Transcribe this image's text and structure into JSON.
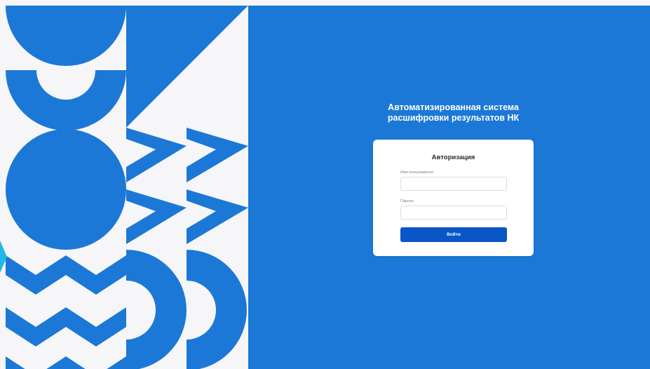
{
  "colors": {
    "brand_blue": "#1c78d6",
    "button_blue": "#0a56c6",
    "background_light": "#f6f6f8",
    "edge_accent": "#20b8e8"
  },
  "header": {
    "title": "Автоматизированная система\nрасшифровки результатов НК"
  },
  "login": {
    "title": "Авторизация",
    "username_label": "Имя пользователя",
    "username_value": "",
    "password_label": "Пароль",
    "password_value": "",
    "submit_label": "Войти"
  },
  "decoration": {
    "pattern": "geometric-shapes",
    "edge_icon": "chevron-right-icon"
  }
}
